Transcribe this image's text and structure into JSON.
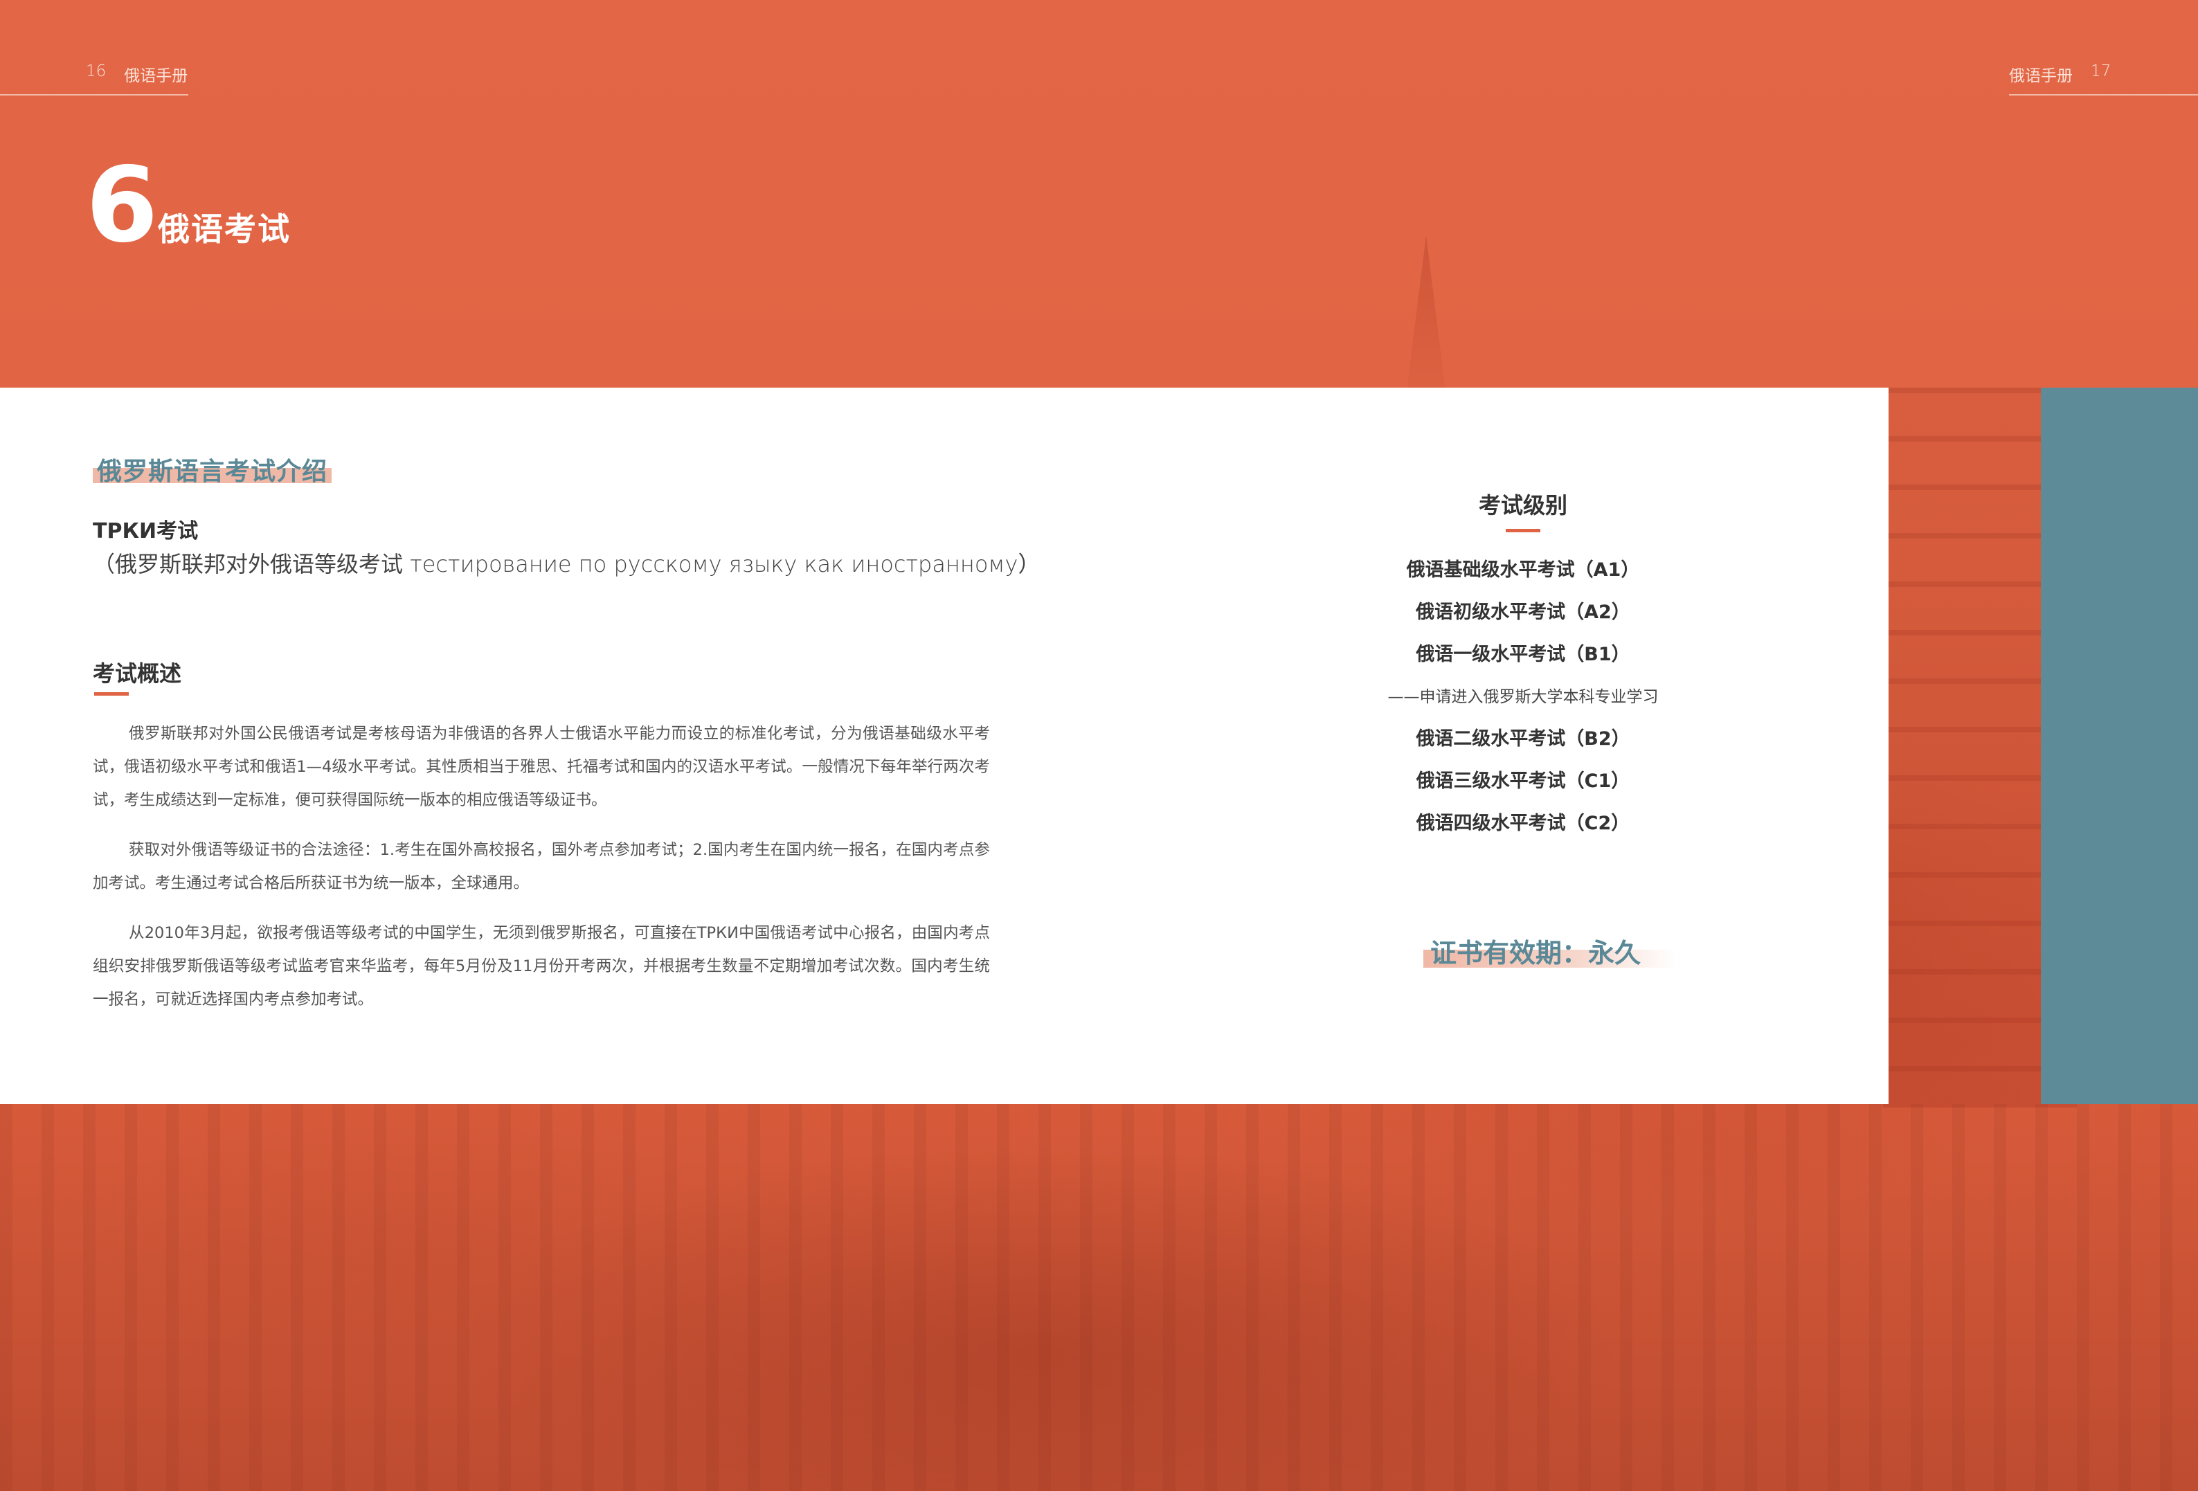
{
  "header": {
    "left_page": "16",
    "left_title": "俄语手册",
    "right_title": "俄语手册",
    "right_page": "17"
  },
  "chapter": {
    "number": "6",
    "title": "俄语考试"
  },
  "intro": {
    "title": "俄罗斯语言考试介绍",
    "exam_name": "ТРКИ考试",
    "exam_full": "（俄罗斯联邦对外俄语等级考试 тестирование по русскому языку как иностранному）"
  },
  "overview": {
    "title": "考试概述",
    "paragraphs": [
      "俄罗斯联邦对外国公民俄语考试是考核母语为非俄语的各界人士俄语水平能力而设立的标准化考试，分为俄语基础级水平考试，俄语初级水平考试和俄语1—4级水平考试。其性质相当于雅思、托福考试和国内的汉语水平考试。一般情况下每年举行两次考试，考生成绩达到一定标准，便可获得国际统一版本的相应俄语等级证书。",
      "获取对外俄语等级证书的合法途径：1.考生在国外高校报名，国外考点参加考试；2.国内考生在国内统一报名，在国内考点参加考试。考生通过考试合格后所获证书为统一版本，全球通用。",
      "从2010年3月起，欲报考俄语等级考试的中国学生，无须到俄罗斯报名，可直接在ТРКИ中国俄语考试中心报名，由国内考点组织安排俄罗斯俄语等级考试监考官来华监考，每年5月份及11月份开考两次，并根据考生数量不定期增加考试次数。国内考生统一报名，可就近选择国内考点参加考试。"
    ]
  },
  "levels": {
    "title": "考试级别",
    "items": [
      "俄语基础级水平考试（A1）",
      "俄语初级水平考试（A2）",
      "俄语一级水平考试（B1）",
      "——申请进入俄罗斯大学本科专业学习",
      "俄语二级水平考试（B2）",
      "俄语三级水平考试（C1）",
      "俄语四级水平考试（C2）"
    ]
  },
  "validity": "证书有效期：永久",
  "colors": {
    "accent": "#e06443",
    "teal": "#5d8b97",
    "highlight": "#f0b8a6"
  }
}
